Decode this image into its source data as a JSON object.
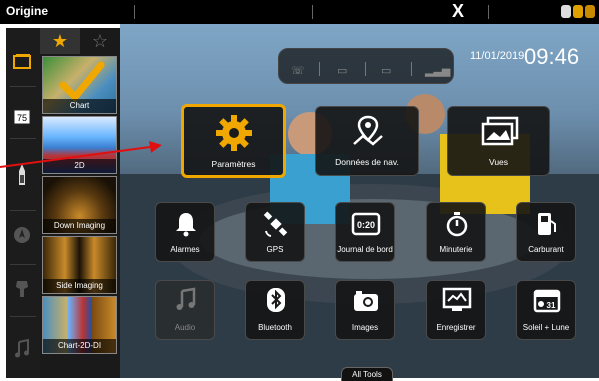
{
  "window": {
    "title": "Origine",
    "close_glyph": "X"
  },
  "status_pill": {
    "mini_label": ""
  },
  "datetime": {
    "date": "11/01/2019",
    "time": "09:46"
  },
  "favorites": {
    "tabs": [
      "★",
      "☆"
    ],
    "tiles": [
      {
        "label": "Chart"
      },
      {
        "label": "2D"
      },
      {
        "label": "Down Imaging"
      },
      {
        "label": "Side Imaging"
      },
      {
        "label": "Chart-2D-DI"
      }
    ]
  },
  "rail": {
    "badge": "75"
  },
  "tools": {
    "parametres": "Paramètres",
    "donnees_nav": "Données de nav.",
    "vues": "Vues",
    "alarmes": "Alarmes",
    "gps": "GPS",
    "journal": "Journal de bord",
    "minuterie": "Minuterie",
    "carburant": "Carburant",
    "audio": "Audio",
    "bluetooth": "Bluetooth",
    "images": "Images",
    "enregistrer": "Enregistrer",
    "soleil_lune": "Soleil + Lune"
  },
  "journal_badge": "0:20",
  "soleil_badge": "31",
  "all_tools": "All Tools",
  "colors": {
    "accent": "#f0a800",
    "arrow": "#e01010",
    "bar": "#000000"
  }
}
